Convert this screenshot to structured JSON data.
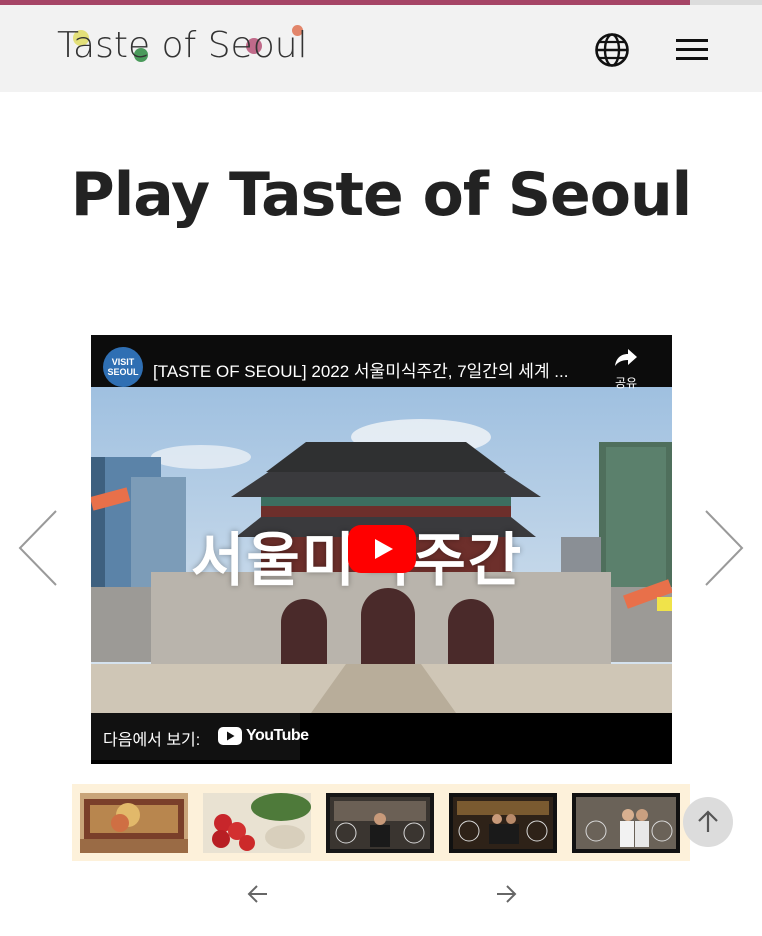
{
  "progress": {
    "fraction": 0.905,
    "fill_color": "#a64566"
  },
  "header": {
    "logo_text": "Taste of Seoul",
    "globe_icon": "globe-icon",
    "menu_icon": "hamburger-menu-icon"
  },
  "page": {
    "title": "Play Taste of Seoul"
  },
  "video": {
    "channel_avatar_text": "VISIT SEOUL",
    "title": "[TASTE OF SEOUL] 2022 서울미식주간, 7일간의 세계 ...",
    "share_label": "공유",
    "overlay_text": "서울미식주간",
    "watch_on_label": "다음에서 보기:",
    "youtube_label": "YouTube"
  },
  "carousel": {
    "prev_icon": "chevron-left-icon",
    "next_icon": "chevron-right-icon"
  },
  "thumbnails": {
    "count": 5,
    "items": [
      "giftbox",
      "apples",
      "chef",
      "bar",
      "chefs-pair"
    ]
  },
  "pager": {
    "prev_icon": "arrow-left-icon",
    "next_icon": "arrow-right-icon"
  },
  "scroll_top_icon": "arrow-up-icon",
  "colors": {
    "accent": "#a64566",
    "header_bg": "#f2f2f2",
    "youtube_red": "#ff0000",
    "thumb_strip_bg": "#fdf1da"
  }
}
